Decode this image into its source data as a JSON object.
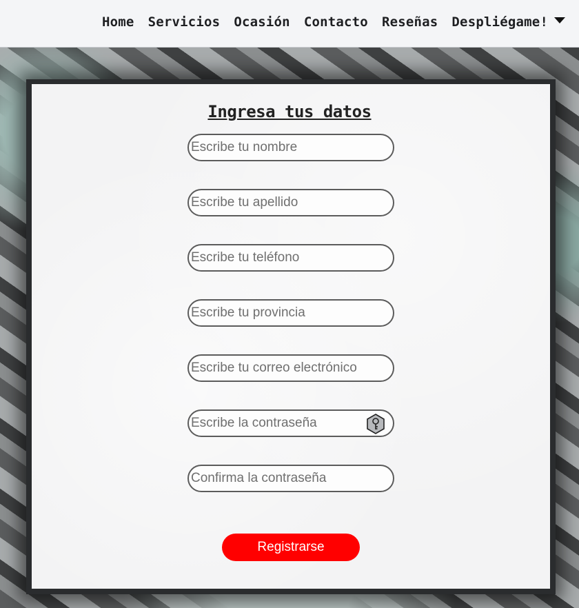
{
  "nav": {
    "items": [
      "Home",
      "Servicios",
      "Ocasión",
      "Contacto",
      "Reseñas",
      "Despliégame!"
    ],
    "dropdown_icon": "caret-down-icon"
  },
  "form": {
    "title": "Ingresa tus datos",
    "fields": [
      {
        "placeholder": "Escribe tu nombre",
        "value": ""
      },
      {
        "placeholder": "Escribe tu apellido",
        "value": ""
      },
      {
        "placeholder": "Escribe tu teléfono",
        "value": ""
      },
      {
        "placeholder": "Escribe tu provincia",
        "value": ""
      },
      {
        "placeholder": "Escribe tu correo electrónico",
        "value": ""
      },
      {
        "placeholder": "Escribe la contraseña",
        "value": "",
        "icon": "key-icon"
      },
      {
        "placeholder": "Confirma la contraseña",
        "value": ""
      }
    ],
    "submit_label": "Registrarse"
  },
  "colors": {
    "submit_bg": "#ff0000",
    "navbar_bg": "#f4f5f7",
    "card_bg": "#f3f3f4"
  }
}
